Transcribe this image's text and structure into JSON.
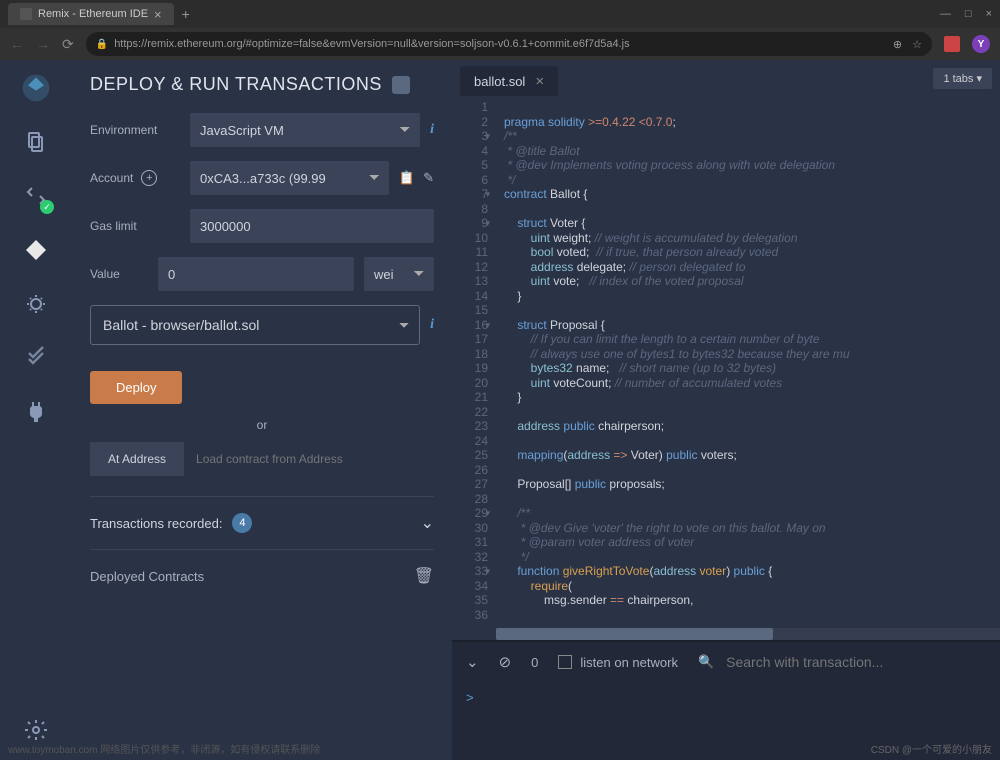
{
  "browser": {
    "tab_title": "Remix - Ethereum IDE",
    "url": "https://remix.ethereum.org/#optimize=false&evmVersion=null&version=soljson-v0.6.1+commit.e6f7d5a4.js",
    "avatar_letter": "Y"
  },
  "panel": {
    "title": "DEPLOY & RUN TRANSACTIONS",
    "env_label": "Environment",
    "env_value": "JavaScript VM",
    "account_label": "Account",
    "account_value": "0xCA3...a733c (99.99",
    "gas_label": "Gas limit",
    "gas_value": "3000000",
    "value_label": "Value",
    "value_value": "0",
    "value_unit": "wei",
    "contract_value": "Ballot - browser/ballot.sol",
    "deploy_btn": "Deploy",
    "or_text": "or",
    "at_address_btn": "At Address",
    "at_address_placeholder": "Load contract from Address",
    "tx_label": "Transactions recorded:",
    "tx_count": "4",
    "deployed_label": "Deployed Contracts"
  },
  "editor": {
    "tab_name": "ballot.sol",
    "tabs_count": "1 tabs",
    "lines": [
      {
        "n": "1",
        "html": ""
      },
      {
        "n": "2",
        "html": "<span class='kw'>pragma</span> <span class='kw'>solidity</span> <span class='op'>&gt;=0.4.22 &lt;0.7.0</span>;"
      },
      {
        "n": "3",
        "fold": "▾",
        "html": "<span class='com'>/**</span>"
      },
      {
        "n": "4",
        "html": "<span class='com'> * @title Ballot</span>"
      },
      {
        "n": "5",
        "html": "<span class='com'> * @dev Implements voting process along with vote delegation</span>"
      },
      {
        "n": "6",
        "html": "<span class='com'> */</span>"
      },
      {
        "n": "7",
        "fold": "▾",
        "html": "<span class='kw'>contract</span> Ballot {"
      },
      {
        "n": "8",
        "html": ""
      },
      {
        "n": "9",
        "fold": "▾",
        "html": "    <span class='kw'>struct</span> Voter {"
      },
      {
        "n": "10",
        "html": "        <span class='type'>uint</span> weight; <span class='com'>// weight is accumulated by delegation</span>"
      },
      {
        "n": "11",
        "html": "        <span class='type'>bool</span> voted;  <span class='com'>// if true, that person already voted</span>"
      },
      {
        "n": "12",
        "html": "        <span class='type'>address</span> delegate; <span class='com'>// person delegated to</span>"
      },
      {
        "n": "13",
        "html": "        <span class='type'>uint</span> vote;   <span class='com'>// index of the voted proposal</span>"
      },
      {
        "n": "14",
        "html": "    }"
      },
      {
        "n": "15",
        "html": ""
      },
      {
        "n": "16",
        "fold": "▾",
        "html": "    <span class='kw'>struct</span> Proposal {"
      },
      {
        "n": "17",
        "html": "        <span class='com'>// If you can limit the length to a certain number of byte</span>"
      },
      {
        "n": "18",
        "html": "        <span class='com'>// always use one of bytes1 to bytes32 because they are mu</span>"
      },
      {
        "n": "19",
        "html": "        <span class='type'>bytes32</span> name;   <span class='com'>// short name (up to 32 bytes)</span>"
      },
      {
        "n": "20",
        "html": "        <span class='type'>uint</span> voteCount; <span class='com'>// number of accumulated votes</span>"
      },
      {
        "n": "21",
        "html": "    }"
      },
      {
        "n": "22",
        "html": ""
      },
      {
        "n": "23",
        "html": "    <span class='type'>address</span> <span class='kw'>public</span> chairperson;"
      },
      {
        "n": "24",
        "html": ""
      },
      {
        "n": "25",
        "html": "    <span class='kw'>mapping</span>(<span class='type'>address</span> <span class='op'>=&gt;</span> Voter) <span class='kw'>public</span> voters;"
      },
      {
        "n": "26",
        "html": ""
      },
      {
        "n": "27",
        "html": "    Proposal[] <span class='kw'>public</span> proposals;"
      },
      {
        "n": "28",
        "html": ""
      },
      {
        "n": "29",
        "fold": "▾",
        "html": "    <span class='com'>/**</span>"
      },
      {
        "n": "30",
        "html": "    <span class='com'> * @dev Give 'voter' the right to vote on this ballot. May on</span>"
      },
      {
        "n": "31",
        "html": "    <span class='com'> * @param voter address of voter</span>"
      },
      {
        "n": "32",
        "html": "    <span class='com'> */</span>"
      },
      {
        "n": "33",
        "fold": "▾",
        "html": "    <span class='kw'>function</span> <span class='fn'>giveRightToVote</span>(<span class='type'>address</span> <span class='ident'>voter</span>) <span class='kw'>public</span> {"
      },
      {
        "n": "34",
        "html": "        <span class='fn'>require</span>("
      },
      {
        "n": "35",
        "html": "            msg.sender <span class='op'>==</span> chairperson,"
      },
      {
        "n": "36",
        "html": ""
      }
    ]
  },
  "terminal": {
    "count": "0",
    "listen_label": "listen on network",
    "search_placeholder": "Search with transaction...",
    "prompt": ">"
  },
  "watermark_right": "CSDN @一个可爱的小朋友",
  "watermark_left": "www.toymoban.com 网络图片仅供参考，非闭源，如有侵权请联系删除"
}
